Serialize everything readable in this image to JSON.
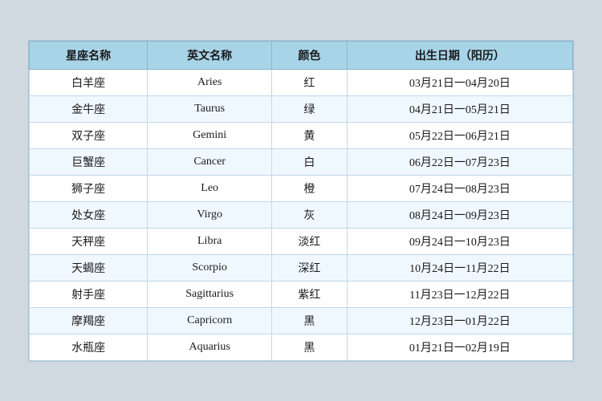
{
  "table": {
    "headers": [
      "星座名称",
      "英文名称",
      "颜色",
      "出生日期（阳历）"
    ],
    "rows": [
      [
        "白羊座",
        "Aries",
        "红",
        "03月21日一04月20日"
      ],
      [
        "金牛座",
        "Taurus",
        "绿",
        "04月21日一05月21日"
      ],
      [
        "双子座",
        "Gemini",
        "黄",
        "05月22日一06月21日"
      ],
      [
        "巨蟹座",
        "Cancer",
        "白",
        "06月22日一07月23日"
      ],
      [
        "狮子座",
        "Leo",
        "橙",
        "07月24日一08月23日"
      ],
      [
        "处女座",
        "Virgo",
        "灰",
        "08月24日一09月23日"
      ],
      [
        "天秤座",
        "Libra",
        "淡红",
        "09月24日一10月23日"
      ],
      [
        "天蝎座",
        "Scorpio",
        "深红",
        "10月24日一11月22日"
      ],
      [
        "射手座",
        "Sagittarius",
        "紫红",
        "11月23日一12月22日"
      ],
      [
        "摩羯座",
        "Capricorn",
        "黑",
        "12月23日一01月22日"
      ],
      [
        "水瓶座",
        "Aquarius",
        "黑",
        "01月21日一02月19日"
      ]
    ]
  }
}
